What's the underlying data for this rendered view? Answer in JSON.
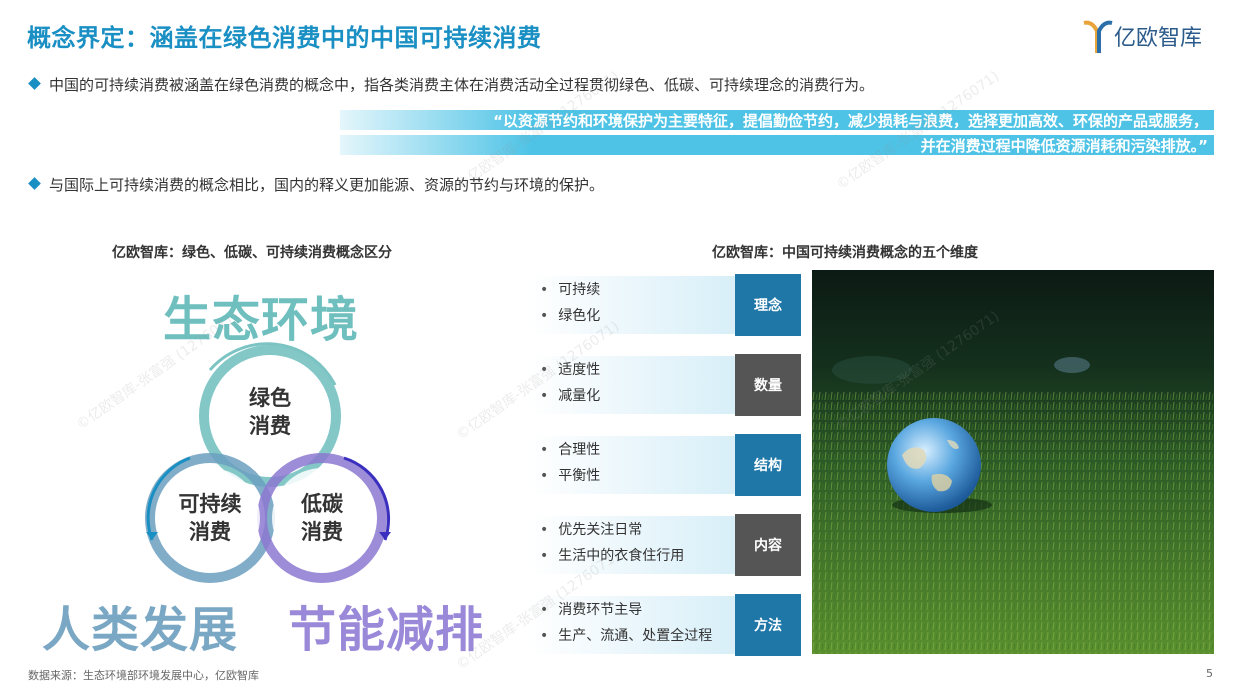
{
  "header": {
    "title": "概念界定：涵盖在绿色消费中的中国可持续消费",
    "logo_text": "亿欧智库"
  },
  "bullets": [
    "中国的可持续消费被涵盖在绿色消费的概念中，指各类消费主体在消费活动全过程贯彻绿色、低碳、可持续理念的消费行为。",
    "与国际上可持续消费的概念相比，国内的释义更加能源、资源的节约与环境的保护。"
  ],
  "quote": {
    "line1": "“以资源节约和环境保护为主要特征，提倡勤俭节约，减少损耗与浪费，选择更加高效、环保的产品或服务，",
    "line2": "并在消费过程中降低资源消耗和污染排放。”"
  },
  "left_panel": {
    "title": "亿欧智库：绿色、低碳、可持续消费概念区分",
    "corner_words": {
      "top": "生态环境",
      "bottom_left": "人类发展",
      "bottom_right": "节能减排"
    },
    "circles": {
      "green": "绿色消费",
      "sustainable": "可持续消费",
      "lowcarbon": "低碳消费"
    }
  },
  "right_panel": {
    "title": "亿欧智库：中国可持续消费概念的五个维度",
    "dimensions": [
      {
        "label": "理念",
        "items": [
          "可持续",
          "绿色化"
        ],
        "color": "#1f77a8"
      },
      {
        "label": "数量",
        "items": [
          "适度性",
          "减量化"
        ],
        "color": "#555555"
      },
      {
        "label": "结构",
        "items": [
          "合理性",
          "平衡性"
        ],
        "color": "#1f77a8"
      },
      {
        "label": "内容",
        "items": [
          "优先关注日常",
          "生活中的衣食住行用"
        ],
        "color": "#555555"
      },
      {
        "label": "方法",
        "items": [
          "消费环节主导",
          "生产、流通、处置全过程"
        ],
        "color": "#1f77a8"
      }
    ]
  },
  "footer": {
    "source": "数据来源：生态环境部环境发展中心，亿欧智库",
    "page": "5"
  },
  "watermark": "©亿欧智库-张富强 (1276071)",
  "colors": {
    "accent": "#1a8fc3",
    "teal": "#6fbfbf",
    "lavender": "#8c78d0",
    "steel": "#5d94b8"
  }
}
